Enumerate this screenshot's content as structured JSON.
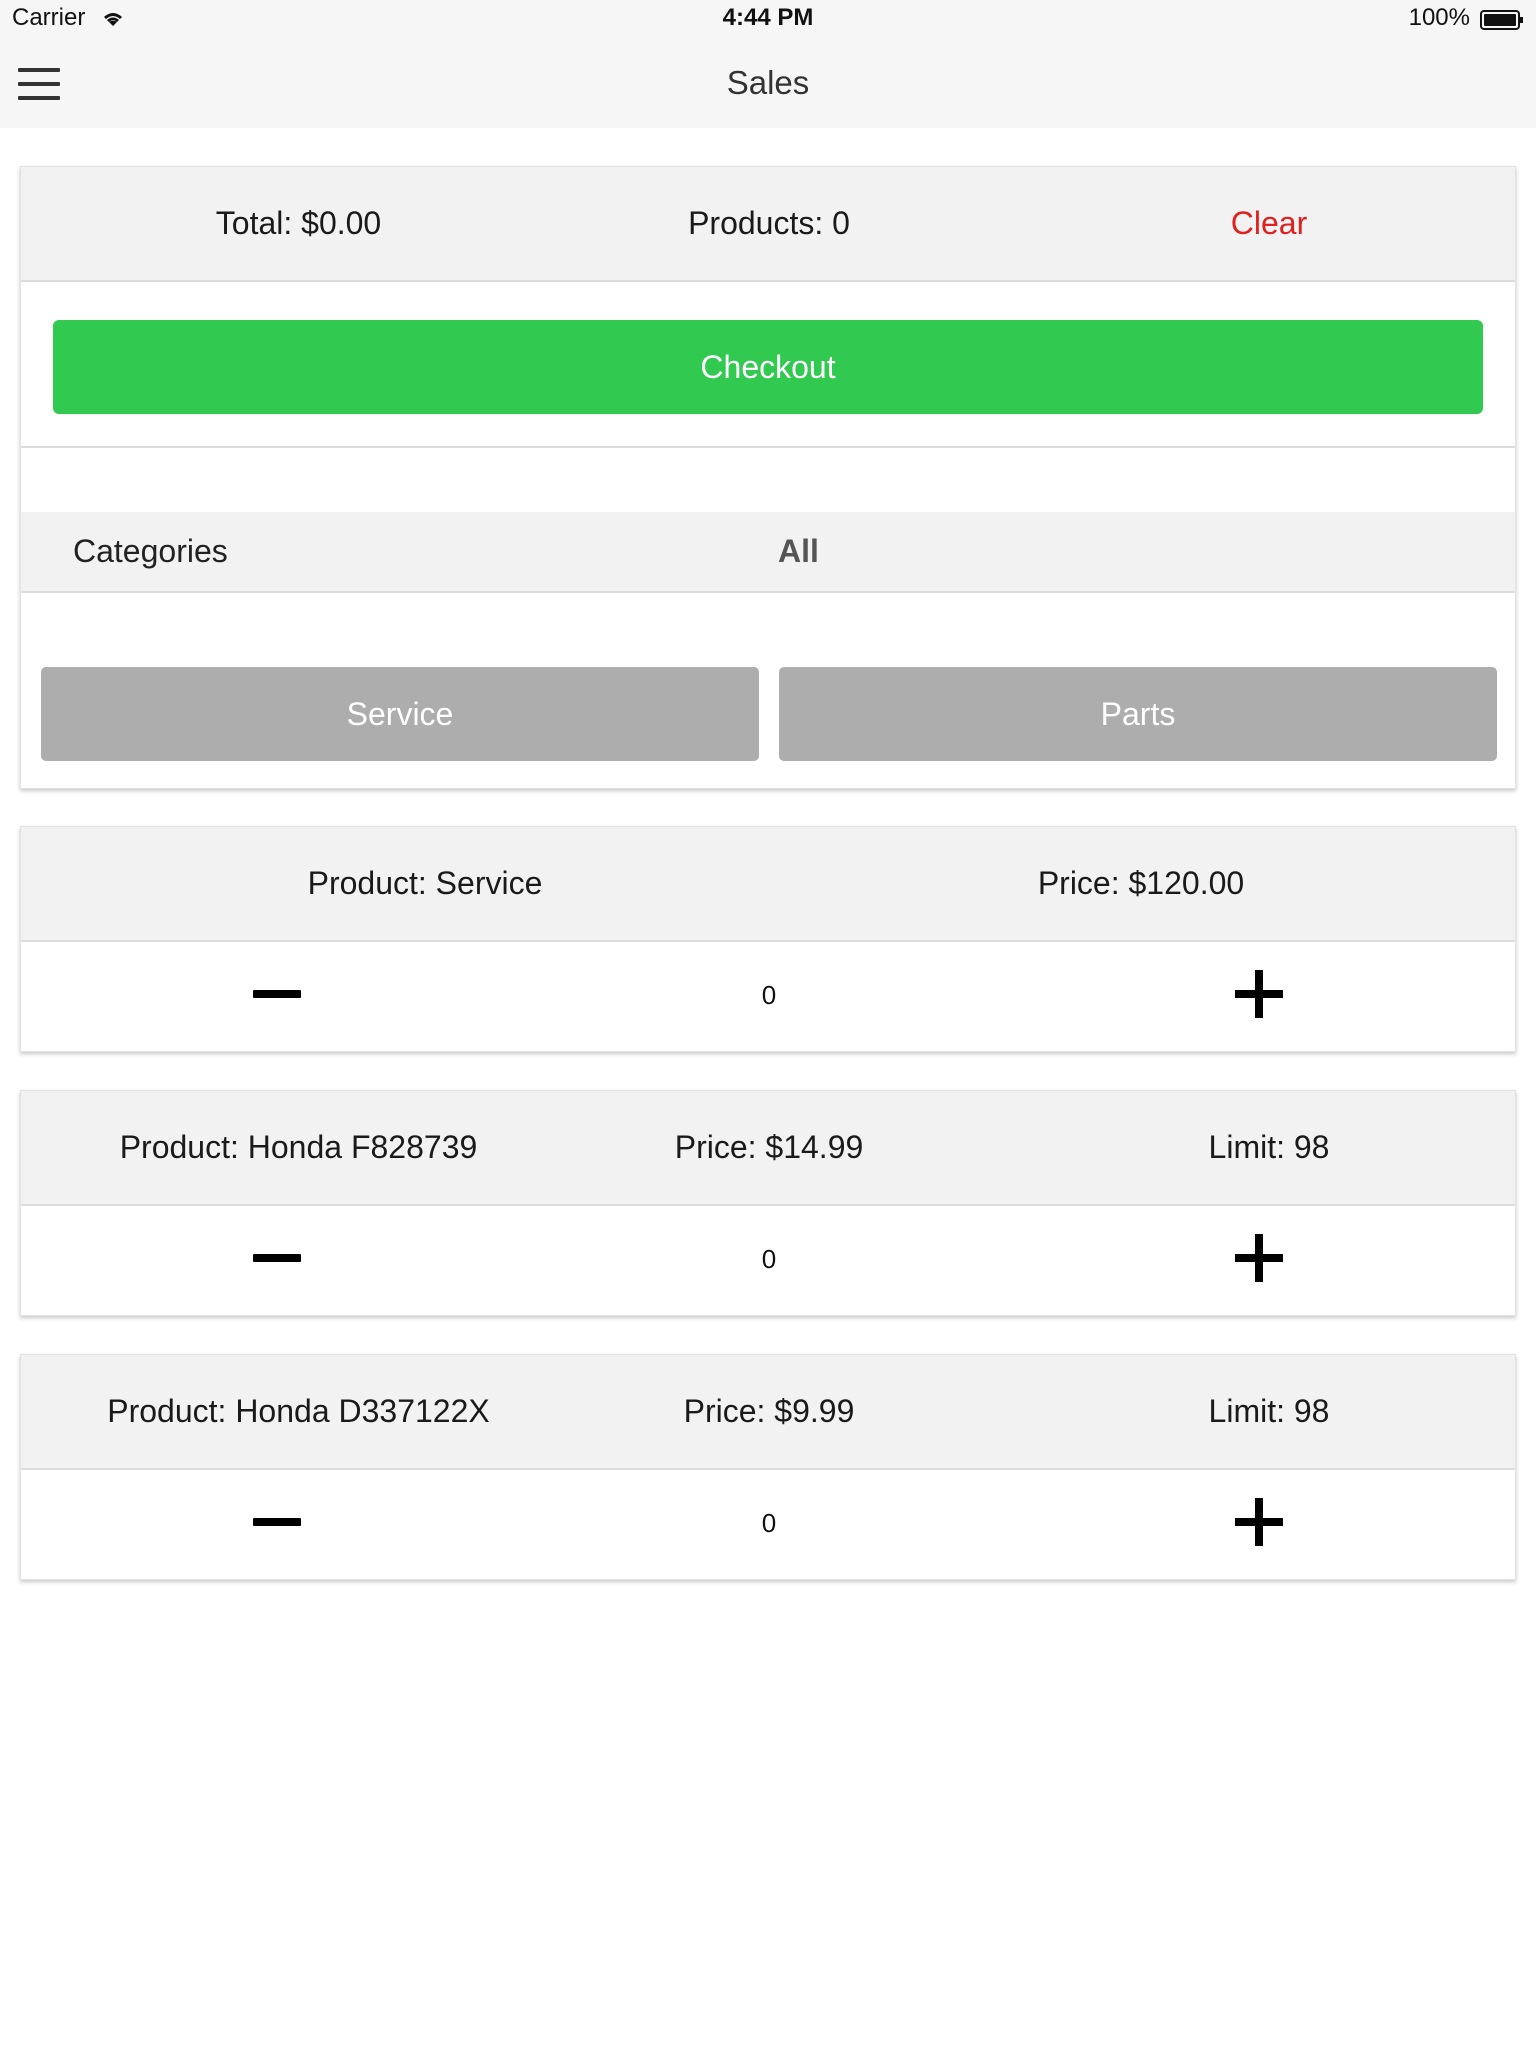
{
  "status_bar": {
    "carrier": "Carrier",
    "time": "4:44 PM",
    "battery": "100%"
  },
  "nav": {
    "title": "Sales"
  },
  "summary": {
    "total": "Total: $0.00",
    "products": "Products: 0",
    "clear_label": "Clear",
    "checkout_label": "Checkout",
    "accent_color": "#31c950",
    "clear_color": "#e0201f"
  },
  "categories": {
    "label": "Categories",
    "selected": "All",
    "buttons": [
      "Service",
      "Parts"
    ]
  },
  "products": [
    {
      "name": "Product: Service",
      "price": "Price: $120.00",
      "quantity": "0"
    },
    {
      "name": "Product: Honda F828739",
      "price": "Price: $14.99",
      "limit": "Limit: 98",
      "quantity": "0"
    },
    {
      "name": "Product: Honda D337122X",
      "price": "Price: $9.99",
      "limit": "Limit: 98",
      "quantity": "0"
    }
  ]
}
